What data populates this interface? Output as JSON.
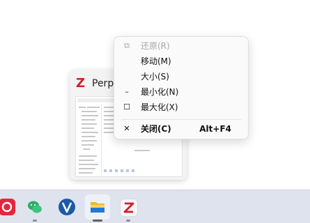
{
  "preview": {
    "title": "Perpl",
    "logo_letter": "Z"
  },
  "menu": {
    "items": [
      {
        "label": "还原(R)",
        "shortcut": "",
        "icon": "restore-icon",
        "glyph": "⧉",
        "enabled": false
      },
      {
        "label": "移动(M)",
        "shortcut": "",
        "icon": "",
        "glyph": "",
        "enabled": true
      },
      {
        "label": "大小(S)",
        "shortcut": "",
        "icon": "",
        "glyph": "",
        "enabled": true
      },
      {
        "label": "最小化(N)",
        "shortcut": "",
        "icon": "minimize-icon",
        "glyph": "–",
        "enabled": true
      },
      {
        "label": "最大化(X)",
        "shortcut": "",
        "icon": "maximize-icon",
        "glyph": "☐",
        "enabled": true
      },
      {
        "label": "关闭(C)",
        "shortcut": "Alt+F4",
        "icon": "close-icon",
        "glyph": "✕",
        "enabled": true
      }
    ]
  },
  "taskbar": {
    "apps": [
      {
        "name": "netease-music-app",
        "color": "#e8243c"
      },
      {
        "name": "wechat-app",
        "color": "#2aae67"
      },
      {
        "name": "v-app",
        "color": "#1c5aa6"
      },
      {
        "name": "file-explorer-app",
        "color": "#f2b82a",
        "active": true
      },
      {
        "name": "zotero-app",
        "color": "#d21d2a"
      }
    ]
  }
}
